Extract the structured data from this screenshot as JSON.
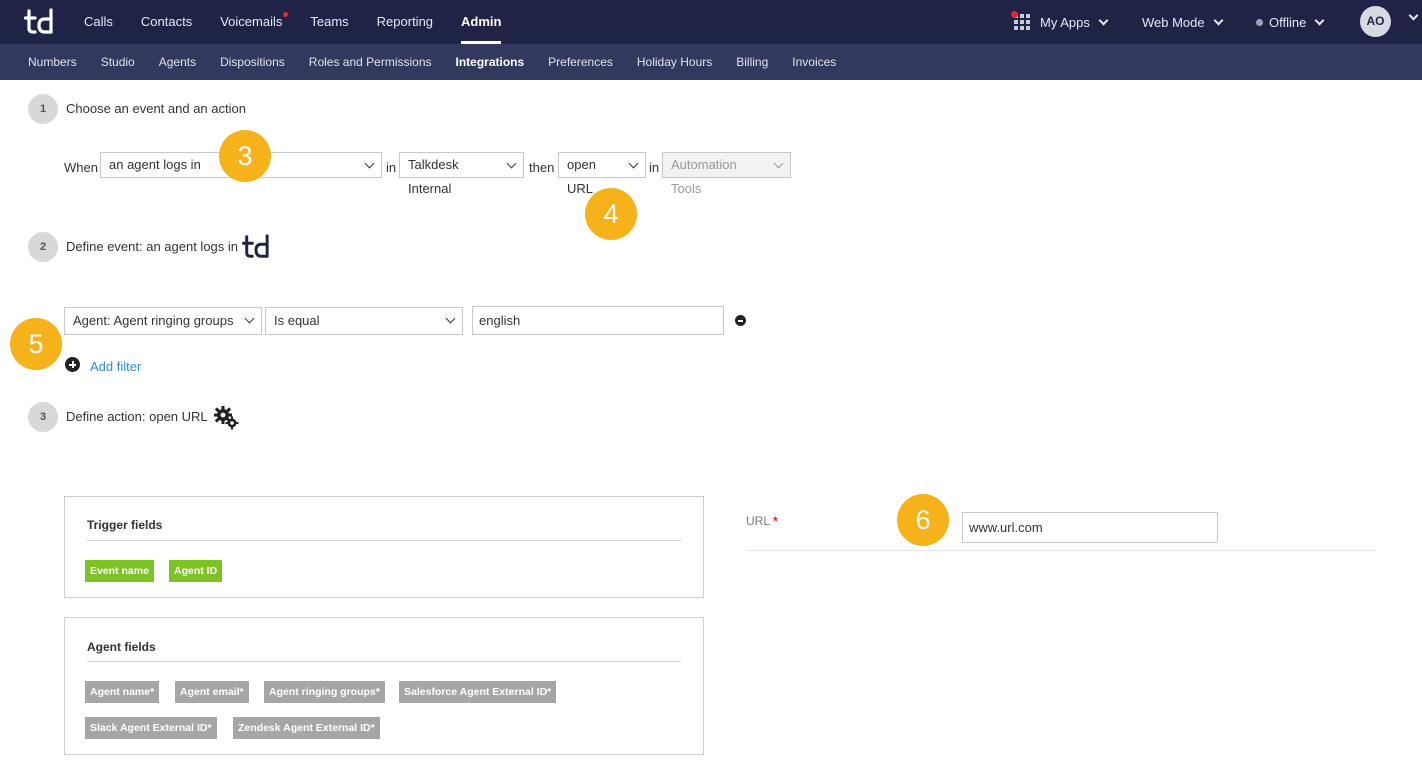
{
  "app": {
    "logo_text": "td"
  },
  "topnav": [
    {
      "label": "Calls"
    },
    {
      "label": "Contacts"
    },
    {
      "label": "Voicemails",
      "has_dot": true
    },
    {
      "label": "Teams"
    },
    {
      "label": "Reporting"
    },
    {
      "label": "Admin",
      "active": true
    }
  ],
  "topright": {
    "my_apps": "My Apps",
    "web_mode": "Web Mode",
    "status": "Offline",
    "avatar_initials": "AO"
  },
  "subnav": [
    {
      "label": "Numbers"
    },
    {
      "label": "Studio"
    },
    {
      "label": "Agents"
    },
    {
      "label": "Dispositions"
    },
    {
      "label": "Roles and Permissions"
    },
    {
      "label": "Integrations",
      "active": true
    },
    {
      "label": "Preferences"
    },
    {
      "label": "Holiday Hours"
    },
    {
      "label": "Billing"
    },
    {
      "label": "Invoices"
    }
  ],
  "step1": {
    "number": "1",
    "title": "Choose an event and an action",
    "when_label": "When",
    "event_select": "an agent logs in",
    "in_label": "in",
    "source_select": "Talkdesk Internal",
    "then_label": "then",
    "action_select": "open URL",
    "in_label_2": "in",
    "target_select": "Automation Tools"
  },
  "step2": {
    "number": "2",
    "title": "Define event: an agent logs in",
    "filter_field": "Agent: Agent ringing groups",
    "filter_operator": "Is equal",
    "filter_value": "english",
    "add_filter": "Add filter"
  },
  "step3": {
    "number": "3",
    "title": "Define action: open URL"
  },
  "trigger_fields": {
    "title": "Trigger fields",
    "tags": [
      "Event name",
      "Agent ID"
    ]
  },
  "agent_fields": {
    "title": "Agent fields",
    "tags": [
      "Agent name*",
      "Agent email*",
      "Agent ringing groups*",
      "Salesforce Agent External ID*",
      "Slack Agent External ID*",
      "Zendesk Agent External ID*"
    ]
  },
  "url_field": {
    "label": "URL",
    "required_mark": "*",
    "value": "www.url.com"
  },
  "callouts": [
    "3",
    "4",
    "5",
    "6"
  ],
  "colors": {
    "topbar": "#1f2447",
    "subbar": "#33395e",
    "callout": "#f6b21b",
    "tag_green": "#7ec325",
    "tag_gray": "#a6a6a6",
    "link": "#2f8ed7",
    "required": "#e7262f"
  }
}
